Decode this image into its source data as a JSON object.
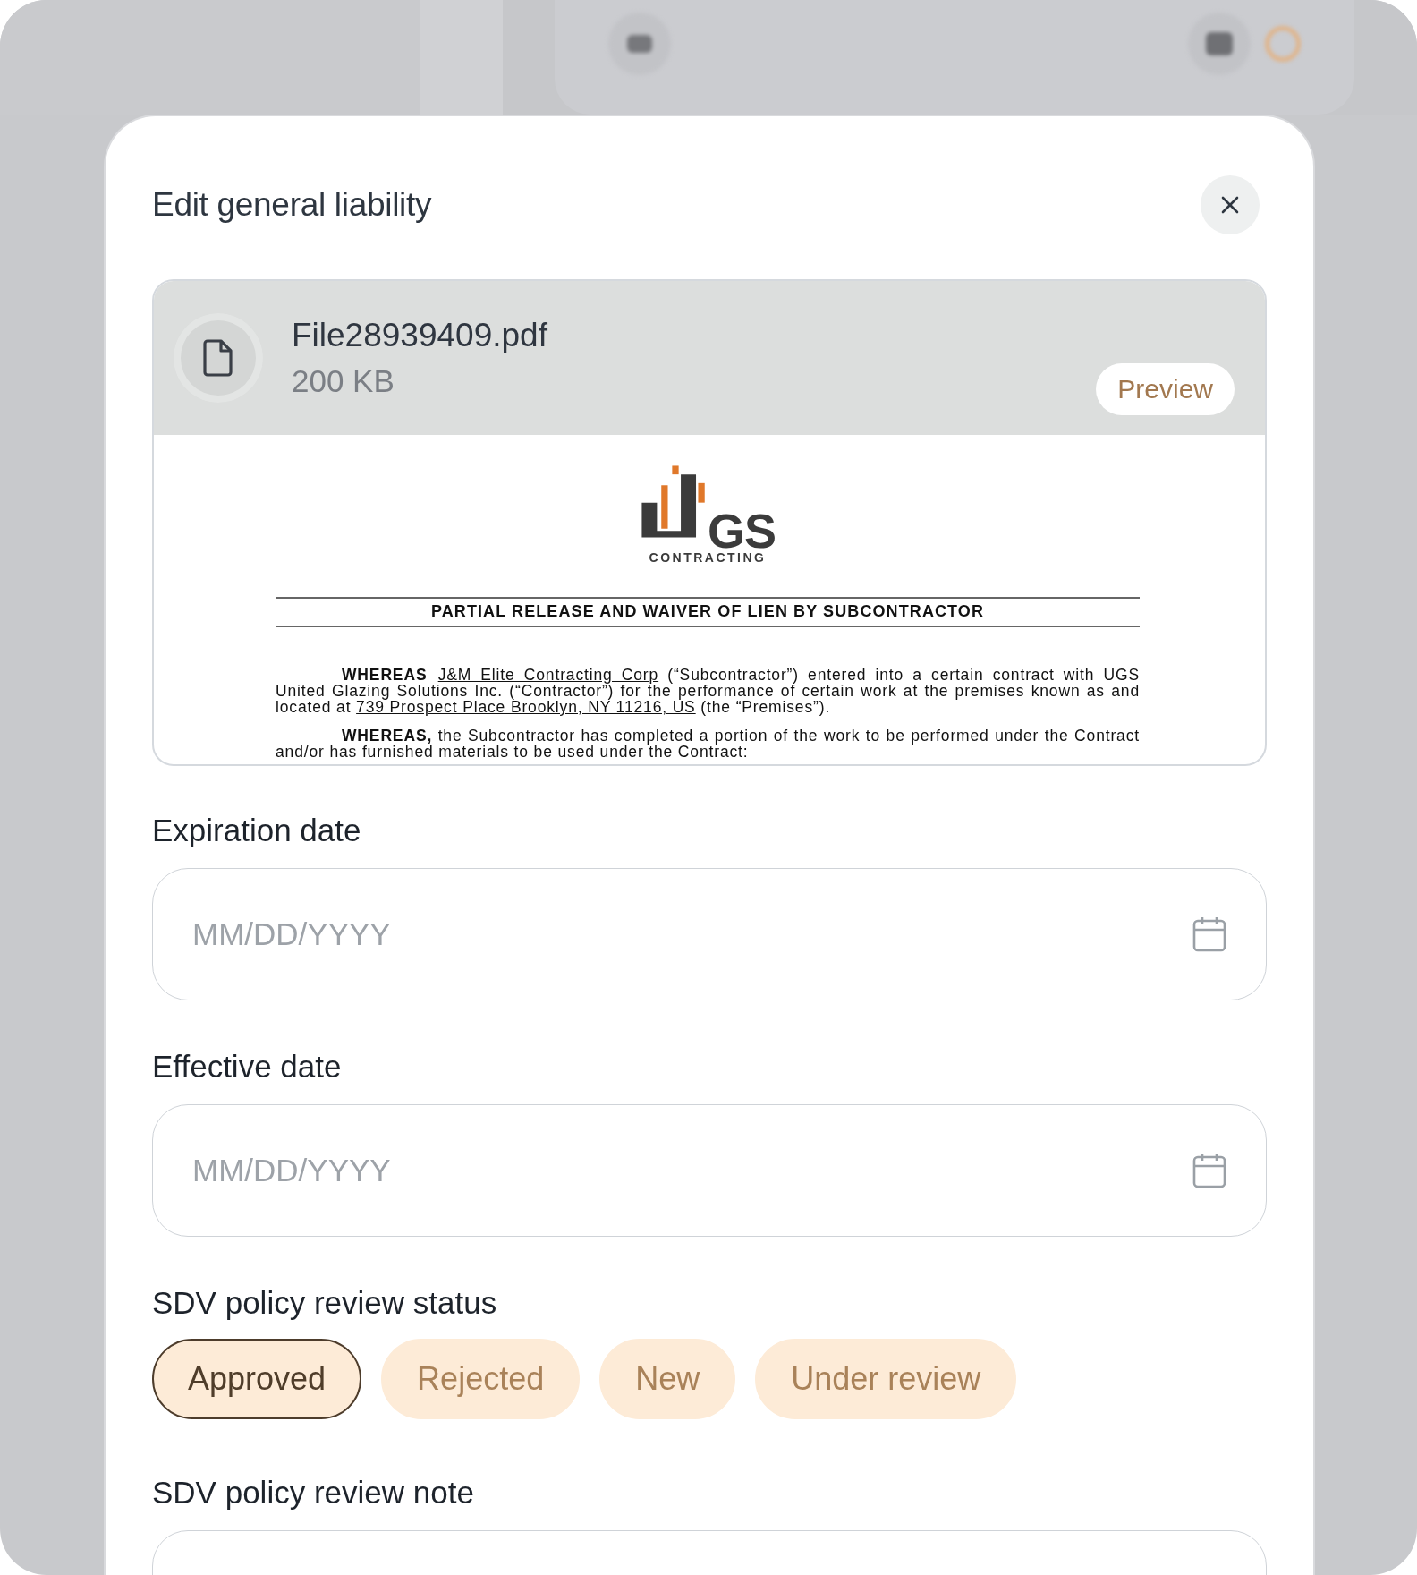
{
  "dialog": {
    "title": "Edit general liability"
  },
  "file": {
    "name": "File28939409.pdf",
    "size": "200 KB",
    "preview_button": "Preview"
  },
  "document": {
    "logo_mark": "GS",
    "logo_tagline": "CONTRACTING",
    "heading": "PARTIAL RELEASE AND WAIVER OF LIEN BY SUBCONTRACTOR",
    "paragraphs": [
      [
        {
          "kind": "bold",
          "text": "WHEREAS"
        },
        {
          "kind": "link",
          "text": "J&M Elite Contracting Corp"
        },
        {
          "kind": "plain",
          "text": " (“Subcontractor”) entered into a certain contract with UGS United Glazing Solutions Inc. (“Contractor”) for the performance of certain work at the premises known as and located at "
        },
        {
          "kind": "link",
          "text": "739 Prospect Place Brooklyn, NY 11216, US"
        },
        {
          "kind": "plain",
          "text": " (the “Premises”)."
        }
      ],
      [
        {
          "kind": "bold",
          "text": "WHEREAS,"
        },
        {
          "kind": "plain",
          "text": " the Subcontractor has completed a portion of the work to be performed under the Contract and/or has furnished materials to be used under the Contract:"
        }
      ]
    ]
  },
  "date_fields": [
    {
      "label": "Expiration date",
      "placeholder": "MM/DD/YYYY"
    },
    {
      "label": "Effective date",
      "placeholder": "MM/DD/YYYY"
    }
  ],
  "review_status": {
    "label": "SDV policy review status",
    "options": [
      {
        "label": "Approved",
        "selected": true
      },
      {
        "label": "Rejected",
        "selected": false
      },
      {
        "label": "New",
        "selected": false
      },
      {
        "label": "Under review",
        "selected": false
      }
    ]
  },
  "review_note": {
    "label": "SDV policy review note"
  }
}
